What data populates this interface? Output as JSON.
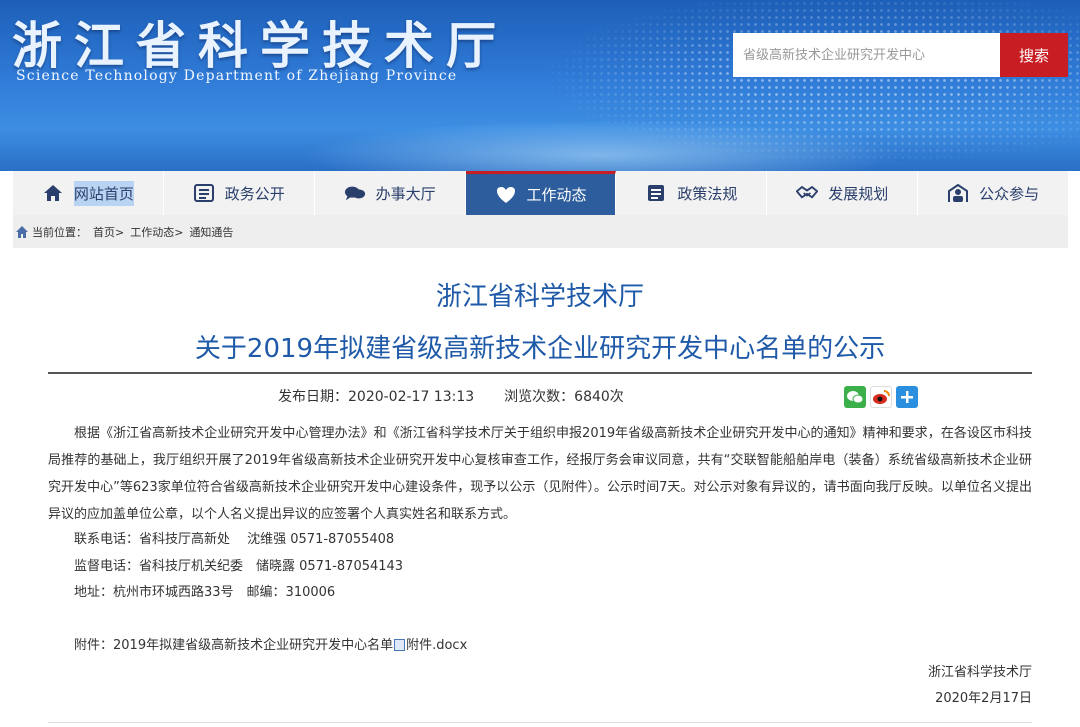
{
  "header": {
    "title": "浙江省科学技术厅",
    "subtitle": "Science Technology Department of Zhejiang Province",
    "search_placeholder": "省级高新技术企业研究开发中心",
    "search_button": "搜索",
    "brand_color": "#1d5fb8",
    "accent_color": "#c71d23"
  },
  "nav": {
    "items": [
      {
        "label": "网站首页",
        "icon": "home-icon"
      },
      {
        "label": "政务公开",
        "icon": "list-icon"
      },
      {
        "label": "办事大厅",
        "icon": "chat-icon"
      },
      {
        "label": "工作动态",
        "icon": "heart-icon"
      },
      {
        "label": "政策法规",
        "icon": "document-icon"
      },
      {
        "label": "发展规划",
        "icon": "handshake-icon"
      },
      {
        "label": "公众参与",
        "icon": "people-icon"
      }
    ],
    "active": "工作动态"
  },
  "breadcrumb": {
    "prefix": "当前位置：",
    "items": [
      "首页>",
      "工作动态>",
      "通知通告"
    ]
  },
  "article": {
    "org": "浙江省科学技术厅",
    "title": "关于2019年拟建省级高新技术企业研究开发中心名单的公示",
    "publish_label": "发布日期：",
    "publish_date": "2020-02-17 13:13",
    "views_label": "浏览次数：",
    "views": "6840次",
    "body": "根据《浙江省高新技术企业研究开发中心管理办法》和《浙江省科学技术厅关于组织申报2019年省级高新技术企业研究开发中心的通知》精神和要求，在各设区市科技局推荐的基础上，我厅组织开展了2019年省级高新技术企业研究开发中心复核审查工作，经报厅务会审议同意，共有“交联智能船舶岸电（装备）系统省级高新技术企业研究开发中心”等623家单位符合省级高新技术企业研究开发中心建设条件，现予以公示（见附件）。公示时间7天。对公示对象有异议的，请书面向我厅反映。以单位名义提出异议的应加盖单位公章，以个人名义提出异议的应签署个人真实姓名和联系方式。",
    "contact": "联系电话：省科技厅高新处　 沈维强 0571-87055408",
    "supervise": "监督电话：省科技厅机关纪委　储晓露 0571-87054143",
    "address": "地址：杭州市环城西路33号　邮编：310006",
    "attachment_prefix": "附件：2019年拟建省级高新技术企业研究开发中心名单",
    "attachment_file": "附件.docx",
    "sign_org": "浙江省科学技术厅",
    "sign_date": "2020年2月17日"
  }
}
